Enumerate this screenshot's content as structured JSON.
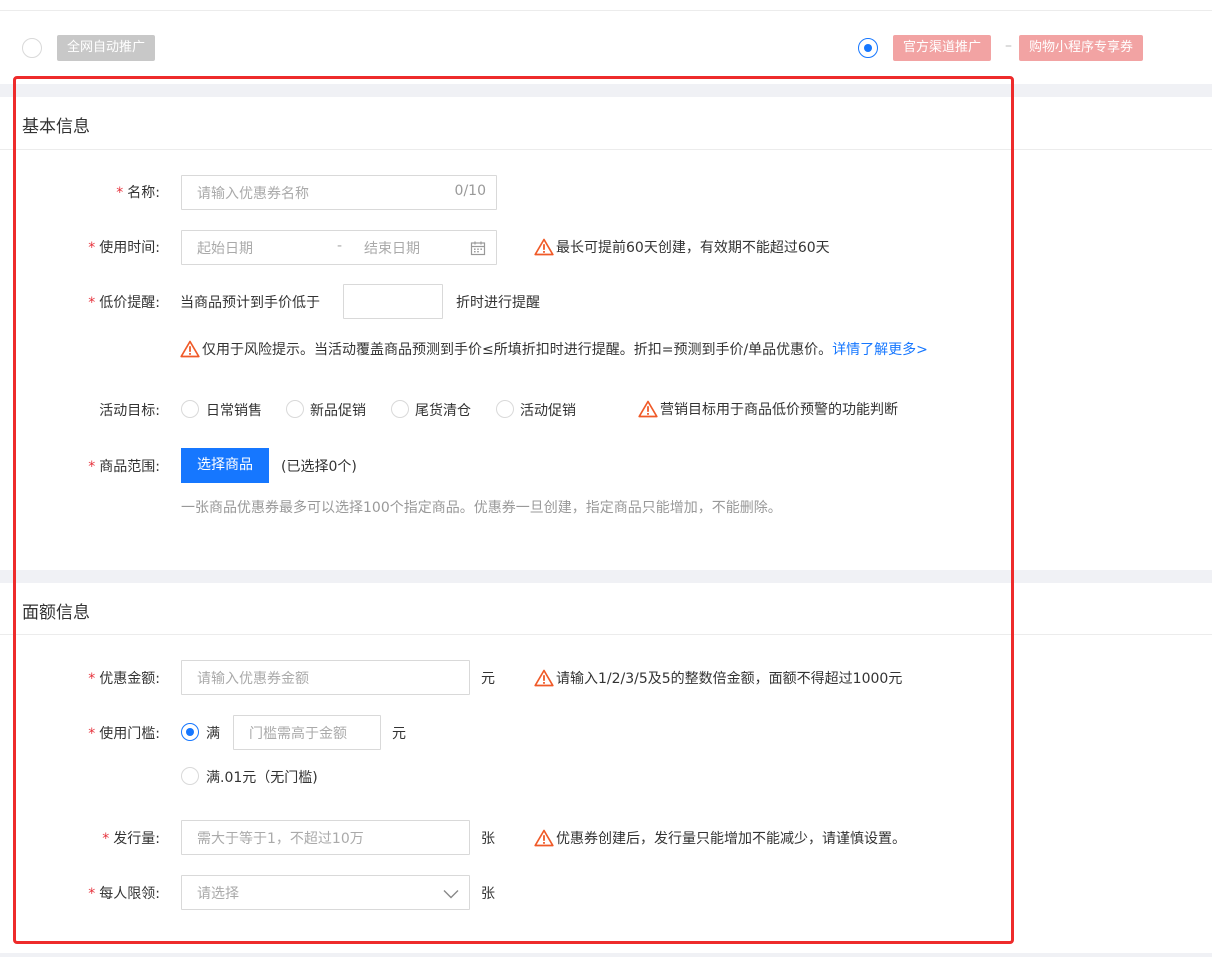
{
  "promo": {
    "auto_label": "全网自动推广",
    "official_label": "官方渠道推广",
    "separator": "–",
    "mini_label": "购物小程序专享券"
  },
  "basic": {
    "title": "基本信息",
    "name": {
      "label": "名称:",
      "placeholder": "请输入优惠券名称",
      "counter": "0/10"
    },
    "time": {
      "label": "使用时间:",
      "start": "起始日期",
      "dash": "-",
      "end": "结束日期",
      "warning": "最长可提前60天创建，有效期不能超过60天"
    },
    "lowprice": {
      "label": "低价提醒:",
      "prefix": "当商品预计到手价低于",
      "value": "",
      "suffix": "折时进行提醒",
      "warning": "仅用于风险提示。当活动覆盖商品预测到手价≤所填折扣时进行提醒。折扣=预测到手价/单品优惠价。",
      "link": "详情了解更多>"
    },
    "goal": {
      "label": "活动目标:",
      "options": [
        "日常销售",
        "新品促销",
        "尾货清仓",
        "活动促销"
      ],
      "warning": "营销目标用于商品低价预警的功能判断"
    },
    "scope": {
      "label": "商品范围:",
      "button": "选择商品",
      "selected": "(已选择0个)",
      "hint": "一张商品优惠券最多可以选择100个指定商品。优惠券一旦创建，指定商品只能增加，不能删除。"
    }
  },
  "amount": {
    "title": "面额信息",
    "discount": {
      "label": "优惠金额:",
      "placeholder": "请输入优惠券金额",
      "unit": "元",
      "warning": "请输入1/2/3/5及5的整数倍金额，面额不得超过1000元"
    },
    "threshold": {
      "label": "使用门槛:",
      "opt1": "满",
      "placeholder": "门槛需高于金额",
      "unit": "元",
      "opt2": "满.01元（无门槛)"
    },
    "issue": {
      "label": "发行量:",
      "placeholder": "需大于等于1，不超过10万",
      "unit": "张",
      "warning": "优惠券创建后，发行量只能增加不能减少，请谨慎设置。"
    },
    "limit": {
      "label": "每人限领:",
      "placeholder": "请选择",
      "unit": "张"
    }
  },
  "required_mark": "*",
  "colors": {
    "accent": "#1677ff",
    "warning": "#f05a28",
    "required": "#e6323c",
    "highlight_box": "#ee2b2b"
  }
}
